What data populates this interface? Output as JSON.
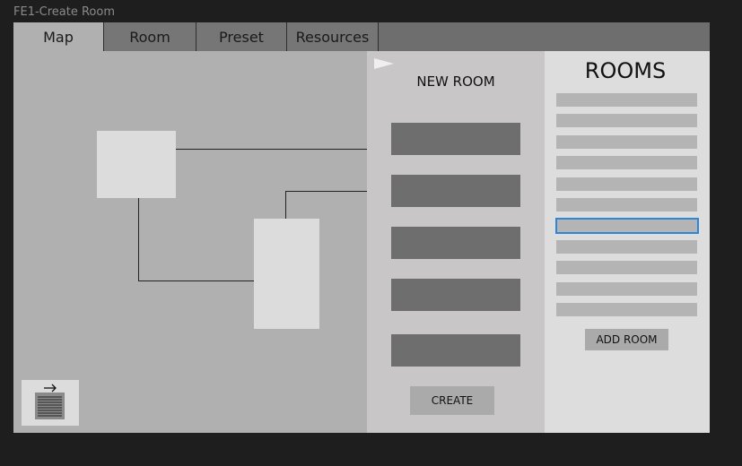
{
  "frame": {
    "title": "FE1-Create Room"
  },
  "tabs": [
    {
      "label": "Map",
      "active": true
    },
    {
      "label": "Room",
      "active": false
    },
    {
      "label": "Preset",
      "active": false
    },
    {
      "label": "Resources",
      "active": false
    }
  ],
  "new_room": {
    "title": "NEW ROOM",
    "field_count": 5,
    "create_label": "CREATE"
  },
  "rooms": {
    "title": "ROOMS",
    "item_count": 11,
    "selected_index": 6,
    "add_label": "ADD ROOM"
  },
  "icons": {
    "collapse": "collapse-arrow-icon",
    "document": "document-arrow-icon"
  },
  "colors": {
    "selection": "#2f86d6",
    "tabbar": "#6e6e6e",
    "field": "#6e6e6e"
  }
}
